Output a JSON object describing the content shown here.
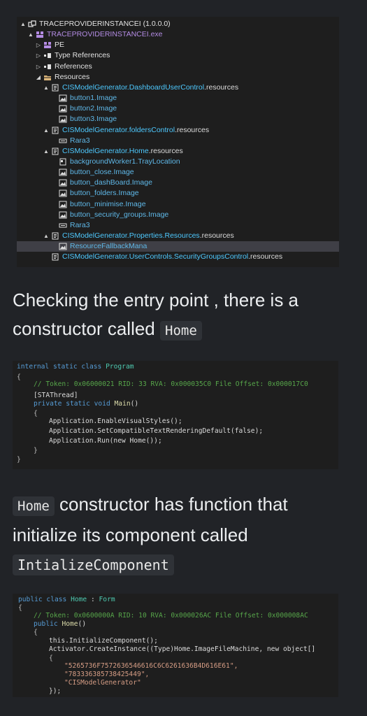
{
  "tree": {
    "rows": [
      {
        "label": "TRACEPROVIDERINSTANCEI (1.0.0.0)",
        "tog": "▲",
        "icon": "assembly-icon",
        "color": "plain"
      },
      {
        "label": "TRACEPROVIDERINSTANCEI.exe",
        "tog": "▲",
        "icon": "module-icon",
        "color": "purple"
      },
      {
        "label": "PE",
        "tog": "▷",
        "icon": "module-icon",
        "color": "plain"
      },
      {
        "label": "Type References",
        "tog": "▷",
        "icon": "references-icon",
        "color": "plain"
      },
      {
        "label": "References",
        "tog": "▷",
        "icon": "references-icon",
        "color": "plain"
      },
      {
        "label": "Resources",
        "tog": "◢",
        "icon": "folder-icon",
        "color": "plain"
      },
      {
        "prefix": "CISModelGenerator.",
        "mid": "DashboardUserControl",
        "suffix": ".resources",
        "tog": "▲",
        "icon": "resource-file-icon",
        "color": "cyan"
      },
      {
        "label": "button1.Image",
        "tog": "",
        "icon": "image-icon",
        "color": "cyan2"
      },
      {
        "label": "button2.Image",
        "tog": "",
        "icon": "image-icon",
        "color": "cyan2"
      },
      {
        "label": "button3.Image",
        "tog": "",
        "icon": "image-icon",
        "color": "cyan2"
      },
      {
        "prefix": "CISModelGenerator.",
        "mid": "foldersControl",
        "suffix": ".resources",
        "tog": "▲",
        "icon": "resource-file-icon",
        "color": "cyan"
      },
      {
        "label": "Rara3",
        "tog": "",
        "icon": "binary-icon",
        "color": "cyan2"
      },
      {
        "prefix": "CISModelGenerator.",
        "mid": "Home",
        "suffix": ".resources",
        "tog": "▲",
        "icon": "resource-file-icon",
        "color": "cyan"
      },
      {
        "label": "backgroundWorker1.TrayLocation",
        "tog": "",
        "icon": "serialized-icon",
        "color": "cyan2"
      },
      {
        "label": "button_close.Image",
        "tog": "",
        "icon": "image-icon",
        "color": "cyan2"
      },
      {
        "label": "button_dashBoard.Image",
        "tog": "",
        "icon": "image-icon",
        "color": "cyan2"
      },
      {
        "label": "button_folders.Image",
        "tog": "",
        "icon": "image-icon",
        "color": "cyan2"
      },
      {
        "label": "button_minimise.Image",
        "tog": "",
        "icon": "image-icon",
        "color": "cyan2"
      },
      {
        "label": "button_security_groups.Image",
        "tog": "",
        "icon": "image-icon",
        "color": "cyan2"
      },
      {
        "label": "Rara3",
        "tog": "",
        "icon": "binary-icon",
        "color": "cyan2"
      },
      {
        "prefix": "CISModelGenerator.",
        "mid": "Properties.Resources",
        "suffix": ".resources",
        "tog": "▲",
        "icon": "resource-file-icon",
        "color": "cyan"
      },
      {
        "label": "ResourceFallbackMana",
        "tog": "",
        "icon": "image-icon",
        "color": "cyan2",
        "selected": true
      },
      {
        "prefix": "CISModelGenerator.",
        "mid": "UserControls.SecurityGroupsControl",
        "suffix": ".resources",
        "tog": "",
        "icon": "resource-file-icon",
        "color": "cyan"
      }
    ]
  },
  "para1": {
    "text": "Checking the entry point , there is a constructor called",
    "code": "Home"
  },
  "para2": {
    "code1": "Home",
    "text": "constructor has function that initialize its component called",
    "code2": "IntializeComponent"
  },
  "code1": {
    "l1_kw": "internal static class",
    "l1_name": "Program",
    "l2": "{",
    "l3": "// Token: 0x06000021 RID: 33 RVA: 0x000035C0 File Offset: 0x000017C0",
    "l4": "[STAThread]",
    "l5_kw": "private static void",
    "l5_fn": "Main",
    "l6": "{",
    "l7": "Application.EnableVisualStyles();",
    "l8": "Application.SetCompatibleTextRenderingDefault(false);",
    "l9": "Application.Run(new Home());",
    "l10": "}",
    "l11": "}"
  },
  "code2": {
    "l1_kw": "public class",
    "l1_name": "Home",
    "l1_base": "Form",
    "l2": "{",
    "l3": "// Token: 0x0600000A RID: 10 RVA: 0x000026AC File Offset: 0x000008AC",
    "l4_kw": "public",
    "l4_fn": "Home",
    "l5": "{",
    "l6": "this.InitializeComponent();",
    "l7": "Activator.CreateInstance((Type)Home.ImageFileMachine, new object[]",
    "l8": "{",
    "l9": "\"5265736F7572636546616C6C6261636B4D616E61\",",
    "l10": "\"783336385738425449\",",
    "l11": "\"CISModelGenerator\"",
    "l12": "});"
  }
}
